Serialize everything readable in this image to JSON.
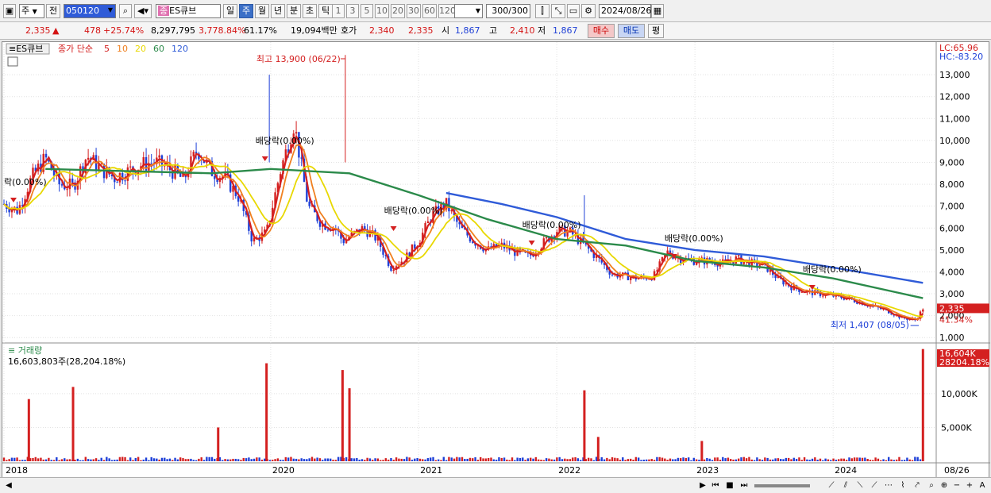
{
  "toolbar": {
    "period_type": "주",
    "prev_label": "전",
    "stock_code": "050120",
    "stock_name": "ES큐브",
    "stock_badge": "종",
    "period_tabs": [
      "일",
      "주",
      "월",
      "년",
      "분",
      "초",
      "틱"
    ],
    "active_period": "주",
    "intervals": [
      "1",
      "3",
      "5",
      "10",
      "20",
      "30",
      "60",
      "120"
    ],
    "count_display": "300",
    "count_total": "/300",
    "date": "2024/08/26"
  },
  "info": {
    "price": "2,335",
    "arrow": "▲",
    "change": "478",
    "change_pct": "+25.74%",
    "volume": "8,297,795",
    "volume_pct": "3,778.84%",
    "turnover": "61.17%",
    "amount": "19,094백만",
    "ask_label": "호가",
    "ask1": "2,340",
    "ask2": "2,335",
    "open_label": "시",
    "open": "1,867",
    "high_label": "고",
    "high": "2,410",
    "low_label": "저",
    "low": "1,867",
    "buy_label": "매수",
    "sell_label": "매도",
    "eval_label": "평"
  },
  "legend": {
    "stock": "ES큐브",
    "ma_title": "종가 단순",
    "ma": [
      {
        "period": "5",
        "color": "#d42020"
      },
      {
        "period": "10",
        "color": "#f08020"
      },
      {
        "period": "20",
        "color": "#e8d800"
      },
      {
        "period": "60",
        "color": "#2b8a4a"
      },
      {
        "period": "120",
        "color": "#2f5bd8"
      }
    ]
  },
  "right_labels": {
    "lc": "LC:65.96",
    "hc": "HC:-83.20",
    "price_tag": "2,335",
    "pct_tag": "41.34%",
    "vol_tag": "16,604K",
    "vol_pct_tag": "28204.18%"
  },
  "annotations": {
    "high": "최고 13,900 (06/22)",
    "low": "최저 1,407 (08/05)",
    "dividends": [
      "락(0.00%)",
      "배당락(0.00%)",
      "배당락(0.00%)",
      "배당락(0.00%)",
      "배당락(0.00%)",
      "배당락(0.00%)"
    ]
  },
  "volume_panel": {
    "title": "거래량",
    "value_line": "16,603,803주(28,204.18%)"
  },
  "chart_data": {
    "type": "candlestick",
    "title": "",
    "xlabel": "",
    "ylabel": "",
    "price_axis_ticks": [
      1000,
      2000,
      3000,
      4000,
      5000,
      6000,
      7000,
      8000,
      9000,
      10000,
      11000,
      12000,
      13000
    ],
    "price_axis_labels": [
      "1,000",
      "2,000",
      "3,000",
      "4,000",
      "5,000",
      "6,000",
      "7,000",
      "8,000",
      "9,000",
      "10,000",
      "11,000",
      "12,000",
      "13,000"
    ],
    "volume_axis_labels": [
      "5,000K",
      "10,000K"
    ],
    "volume_axis_ticks": [
      5000,
      10000
    ],
    "x_axis_labels": [
      "2018",
      "2020",
      "2021",
      "2022",
      "2023",
      "2024",
      "08/26"
    ],
    "x_label_dates": [
      2018.0,
      2019.93,
      2021.0,
      2022.0,
      2023.0,
      2024.0,
      2024.65
    ],
    "price_series": {
      "name": "close",
      "x": [
        2018.0,
        2018.1,
        2018.2,
        2018.3,
        2018.4,
        2018.5,
        2018.6,
        2018.7,
        2018.8,
        2018.9,
        2019.0,
        2019.1,
        2019.2,
        2019.3,
        2019.4,
        2019.5,
        2019.6,
        2019.7,
        2019.8,
        2019.9,
        2020.0,
        2020.1,
        2020.2,
        2020.3,
        2020.4,
        2020.45,
        2020.5,
        2020.6,
        2020.7,
        2020.8,
        2020.9,
        2021.0,
        2021.1,
        2021.2,
        2021.3,
        2021.4,
        2021.5,
        2021.6,
        2021.7,
        2021.8,
        2021.9,
        2022.0,
        2022.1,
        2022.2,
        2022.3,
        2022.4,
        2022.5,
        2022.6,
        2022.7,
        2022.8,
        2022.9,
        2023.0,
        2023.1,
        2023.2,
        2023.3,
        2023.4,
        2023.5,
        2023.6,
        2023.7,
        2023.8,
        2023.9,
        2024.0,
        2024.1,
        2024.2,
        2024.3,
        2024.4,
        2024.5,
        2024.6,
        2024.65
      ],
      "values": [
        7100,
        6800,
        8300,
        9200,
        8000,
        7900,
        9300,
        8700,
        8300,
        8600,
        8900,
        9000,
        8700,
        8200,
        9600,
        8600,
        8300,
        7400,
        5400,
        5800,
        8600,
        10800,
        7000,
        6200,
        6000,
        5400,
        5600,
        6000,
        5500,
        4200,
        4600,
        5400,
        6600,
        7100,
        6000,
        5400,
        5000,
        5200,
        4900,
        4700,
        5300,
        5900,
        5800,
        5200,
        4600,
        3900,
        3800,
        3700,
        3800,
        4900,
        4600,
        4500,
        4500,
        4400,
        4600,
        4400,
        4300,
        3700,
        3300,
        3100,
        3000,
        2900,
        2800,
        2600,
        2400,
        2200,
        1900,
        1800,
        2335
      ]
    },
    "ma_series": [
      {
        "name": "5",
        "note": "closely tracks price"
      },
      {
        "name": "60",
        "x": [
          2018.3,
          2019.5,
          2019.93,
          2020.5,
          2021.0,
          2021.5,
          2022.0,
          2022.5,
          2023.0,
          2023.5,
          2024.0,
          2024.65
        ],
        "values": [
          8700,
          8500,
          8700,
          8500,
          7500,
          6400,
          5500,
          5200,
          4500,
          4200,
          3700,
          2800
        ]
      },
      {
        "name": "120",
        "x": [
          2021.2,
          2021.6,
          2022.0,
          2022.5,
          2023.0,
          2023.5,
          2024.0,
          2024.65
        ],
        "values": [
          7600,
          7100,
          6500,
          5500,
          5000,
          4700,
          4200,
          3500
        ]
      }
    ],
    "volume_spikes_k": [
      {
        "x": 2018.18,
        "value": 9200
      },
      {
        "x": 2018.5,
        "value": 11000
      },
      {
        "x": 2019.55,
        "value": 5000
      },
      {
        "x": 2019.9,
        "value": 14500
      },
      {
        "x": 2020.45,
        "value": 13500
      },
      {
        "x": 2020.5,
        "value": 10800
      },
      {
        "x": 2022.2,
        "value": 10500
      },
      {
        "x": 2022.3,
        "value": 3600
      },
      {
        "x": 2023.05,
        "value": 3000
      },
      {
        "x": 2024.65,
        "value": 16604
      }
    ],
    "price_range": [
      900,
      14200
    ],
    "volume_range": [
      0,
      16800
    ],
    "grid": true
  }
}
